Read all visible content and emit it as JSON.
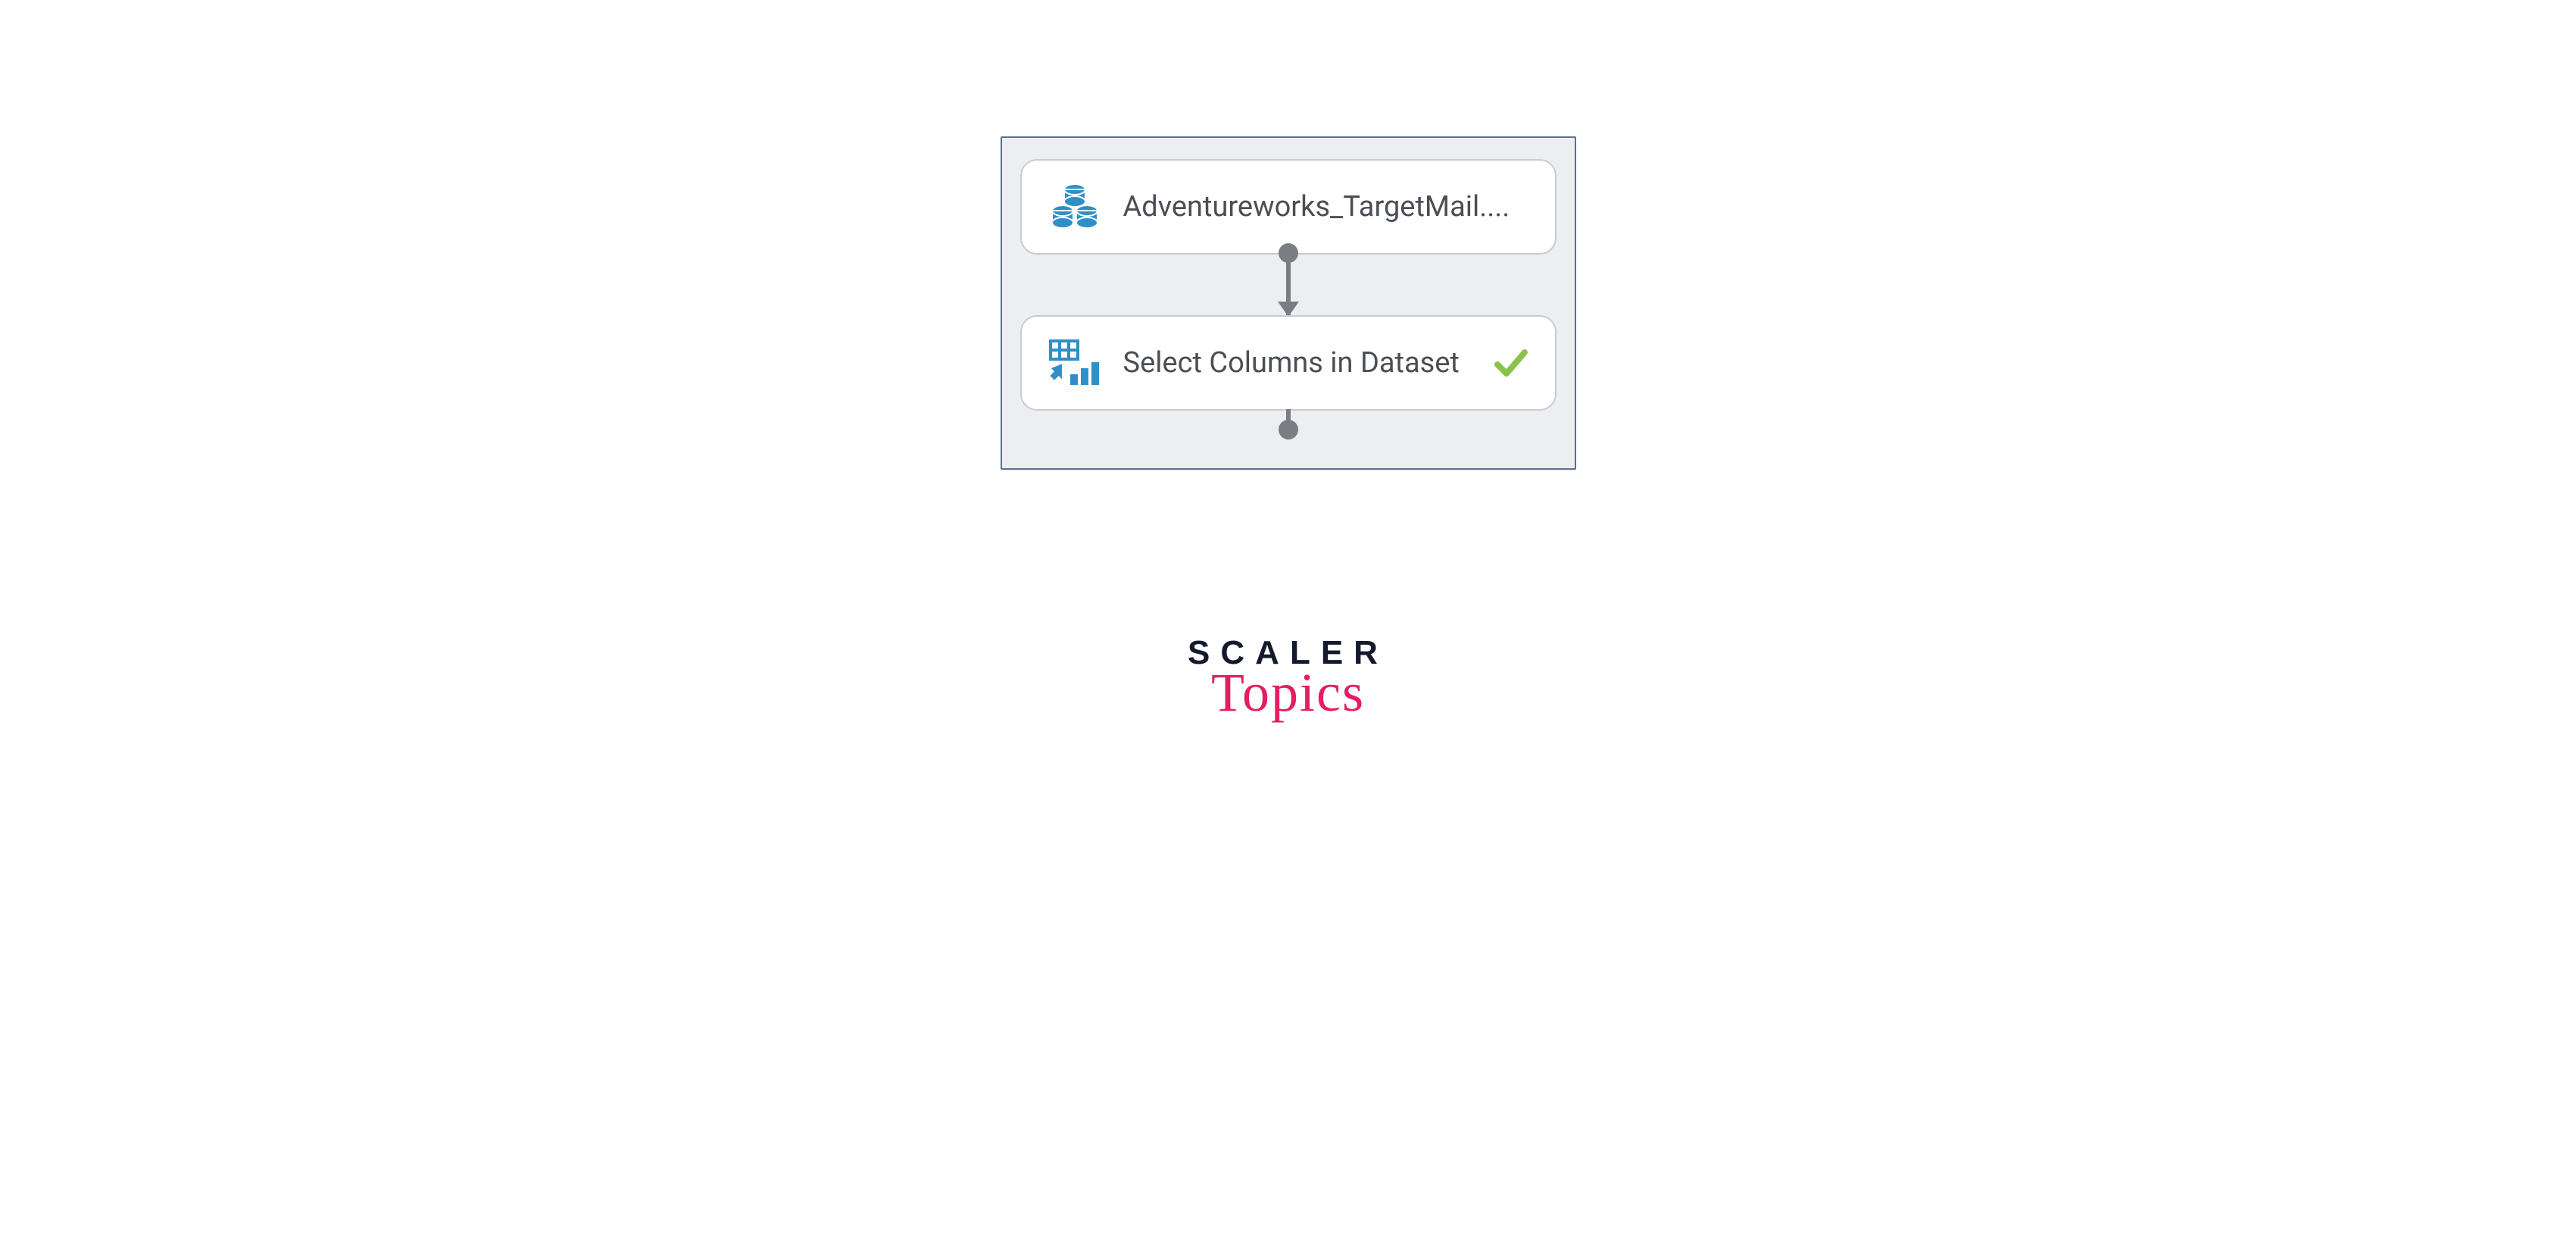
{
  "nodes": {
    "dataset": {
      "label": "Adventureworks_TargetMail....",
      "icon": "dataset-icon"
    },
    "select_columns": {
      "label": "Select Columns in Dataset",
      "icon": "transform-icon",
      "status": "success"
    }
  },
  "watermark": {
    "line1": "SCALER",
    "line2": "Topics"
  },
  "colors": {
    "icon_blue": "#2f8fc6",
    "check_green": "#8bc34a",
    "node_border": "#c8ccd1",
    "canvas_border": "#5b7090",
    "canvas_bg": "#eceef1",
    "port": "#7a7d81"
  }
}
